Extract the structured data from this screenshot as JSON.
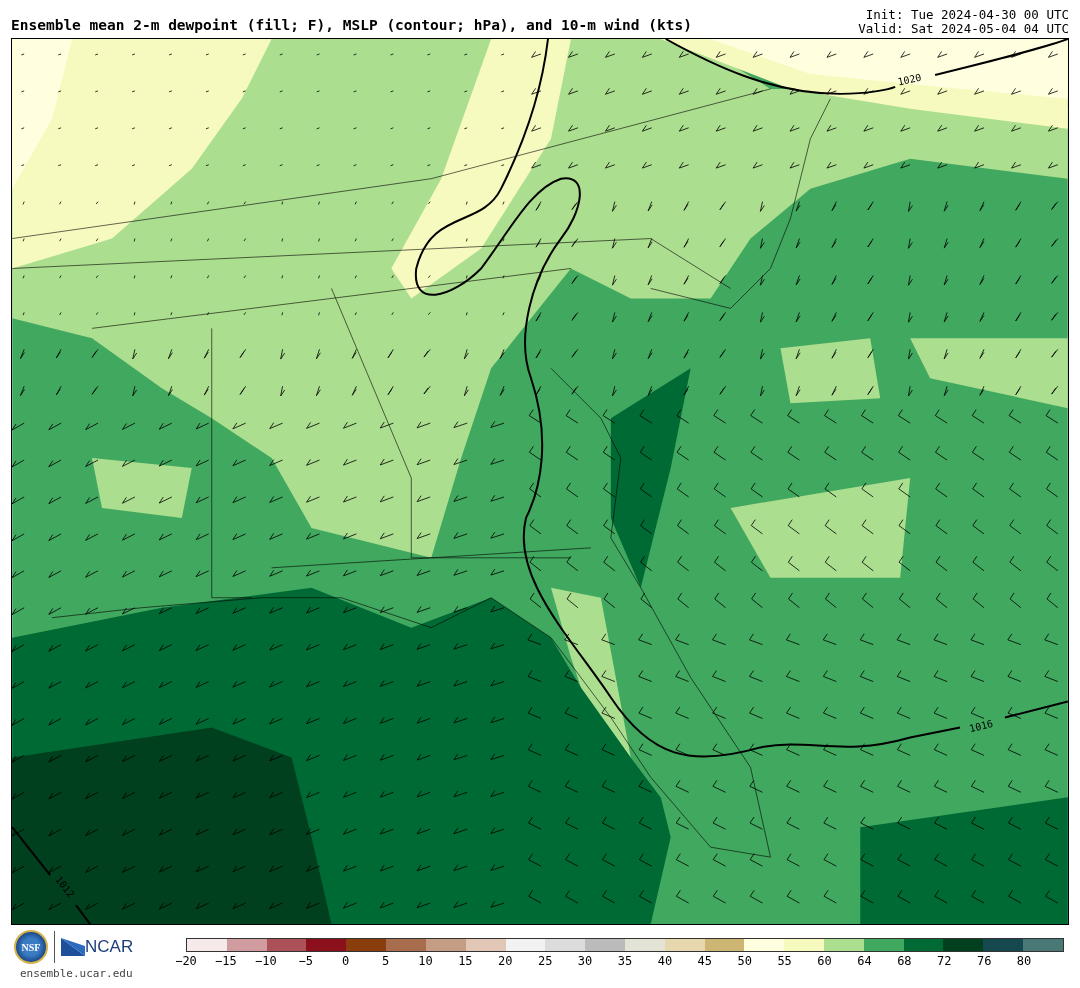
{
  "title": "Ensemble mean 2-m dewpoint (fill; F), MSLP (contour; hPa), and 10-m wind (kts)",
  "init": "Init: Tue 2024-04-30 00 UTC",
  "valid": "Valid: Sat 2024-05-04 04 UTC",
  "map": {
    "contour_labels": [
      "1020",
      "1016",
      "1012"
    ]
  },
  "logo": {
    "nsf": "NSF",
    "ncar": "NCAR",
    "site": "ensemble.ucar.edu"
  },
  "colorbar": {
    "segments": [
      {
        "color": "#f5e9e9"
      },
      {
        "color": "#d09ca0"
      },
      {
        "color": "#ac5157"
      },
      {
        "color": "#8b101c"
      },
      {
        "color": "#8a3e0e"
      },
      {
        "color": "#a86d4d"
      },
      {
        "color": "#c59d84"
      },
      {
        "color": "#e2c7b7"
      },
      {
        "color": "#f2f2f2"
      },
      {
        "color": "#dcdcdc"
      },
      {
        "color": "#bbbbbb"
      },
      {
        "color": "#e3e4d6"
      },
      {
        "color": "#e6d7ae"
      },
      {
        "color": "#cdb674"
      },
      {
        "color": "#ffffe0"
      },
      {
        "color": "#f7fabf"
      },
      {
        "color": "#acde8f"
      },
      {
        "color": "#41a85f"
      },
      {
        "color": "#006a35"
      },
      {
        "color": "#00401f"
      },
      {
        "color": "#15494f"
      },
      {
        "color": "#4a7876"
      }
    ],
    "ticks": [
      "−20",
      "−15",
      "−10",
      "−5",
      "0",
      "5",
      "10",
      "15",
      "20",
      "25",
      "30",
      "35",
      "40",
      "45",
      "50",
      "55",
      "60",
      "64",
      "68",
      "72",
      "76",
      "80"
    ]
  }
}
